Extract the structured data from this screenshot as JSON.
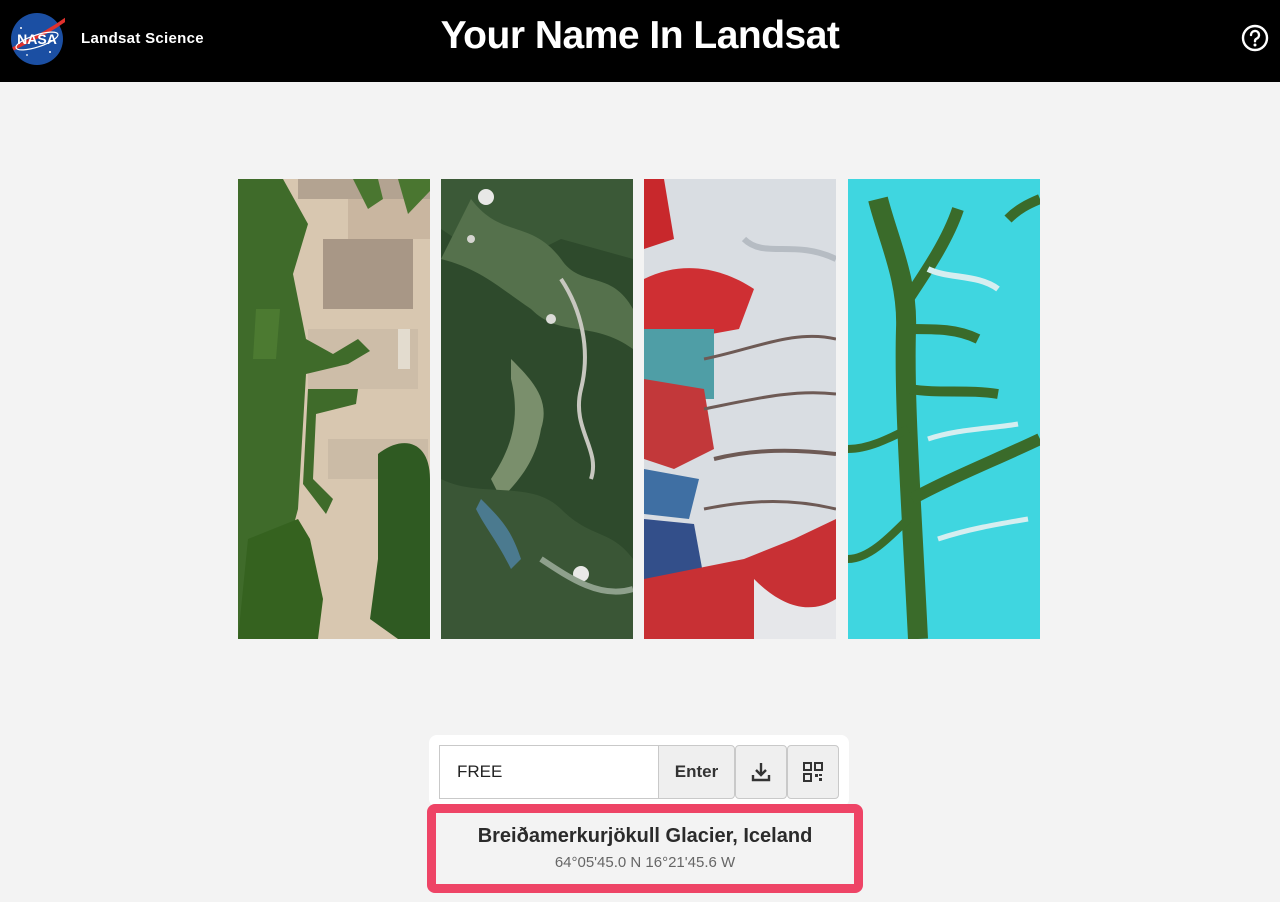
{
  "header": {
    "brand_label": "Landsat Science",
    "logo_text": "NASA",
    "title": "Your Name In Landsat",
    "help_icon": "question-circle-icon"
  },
  "letters": [
    {
      "letter": "F",
      "scene": "farmland-forest"
    },
    {
      "letter": "R",
      "scene": "alpine-valley"
    },
    {
      "letter": "E",
      "scene": "glacier-false-color"
    },
    {
      "letter": "E",
      "scene": "cyan-river-branches"
    }
  ],
  "controls": {
    "name_value": "FREE",
    "enter_label": "Enter",
    "download_icon": "download-icon",
    "qr_icon": "qr-code-icon"
  },
  "location": {
    "name": "Breiðamerkurjökull Glacier, Iceland",
    "coords": "64°05'45.0 N 16°21'45.6 W"
  },
  "colors": {
    "topbar": "#000000",
    "page_bg": "#f3f3f3",
    "highlight_border": "#ee4466"
  }
}
